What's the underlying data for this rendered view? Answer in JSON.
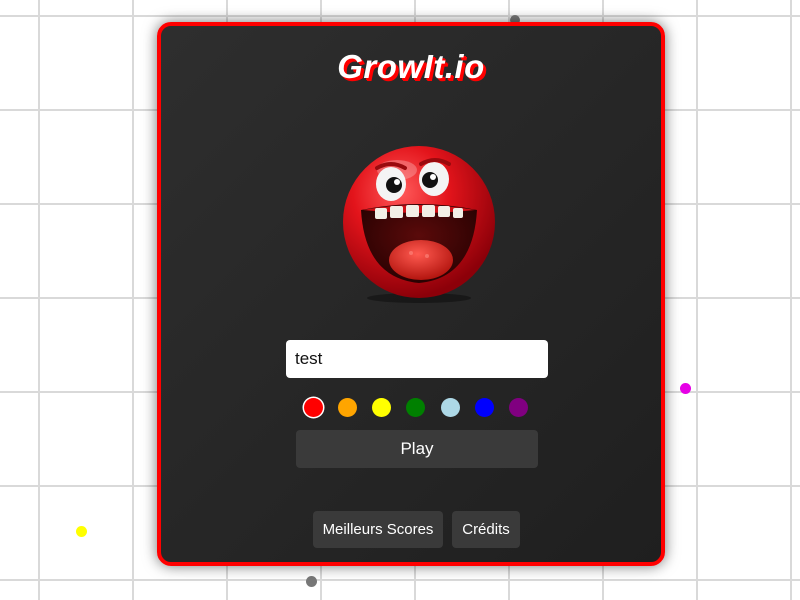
{
  "game": {
    "title": "GrowIt.io"
  },
  "menu": {
    "name_value": "test",
    "colors": [
      "#ff0000",
      "#ffa500",
      "#ffff00",
      "#008000",
      "#add8e6",
      "#0000ff",
      "#800080"
    ],
    "selected_color": "#ff0000",
    "play_label": "Play",
    "scores_label": "Meilleurs Scores",
    "credits_label": "Crédits"
  },
  "mascot": {
    "icon": "red-ball-monster-icon",
    "color": "#e3141b"
  },
  "background": {
    "grid_color": "#d9d9d9",
    "pellets": [
      "#ffff00",
      "#e600e6",
      "#777777",
      "#777777"
    ]
  }
}
